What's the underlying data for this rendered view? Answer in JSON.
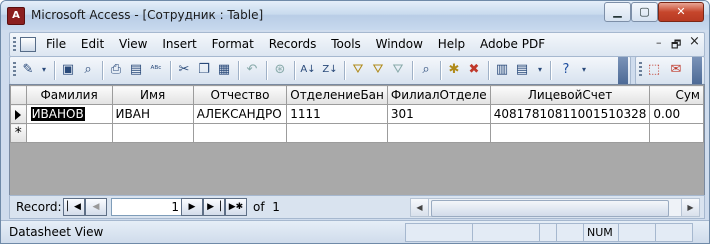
{
  "window": {
    "title": "Microsoft Access - [Сотрудник : Table]",
    "app_icon": "access-key-icon",
    "controls": {
      "minimize": "minimize-icon",
      "maximize": "maximize-icon",
      "close": "close-icon"
    }
  },
  "menubar": {
    "items": [
      {
        "label": "File"
      },
      {
        "label": "Edit"
      },
      {
        "label": "View"
      },
      {
        "label": "Insert"
      },
      {
        "label": "Format"
      },
      {
        "label": "Records"
      },
      {
        "label": "Tools"
      },
      {
        "label": "Window"
      },
      {
        "label": "Help"
      },
      {
        "label": "Adobe PDF"
      }
    ],
    "doc_controls": {
      "minimize": "–",
      "restore": "🗗",
      "close": "×"
    }
  },
  "toolbar": {
    "buttons": [
      "view-icon",
      "save-icon",
      "search-file-icon",
      "print-icon",
      "print-preview-icon",
      "spelling-icon",
      "cut-icon",
      "copy-icon",
      "paste-icon",
      "undo-icon",
      "hyperlink-icon",
      "sort-ascending-icon",
      "sort-descending-icon",
      "filter-by-selection-icon",
      "filter-by-form-icon",
      "apply-filter-icon",
      "find-icon",
      "new-record-icon",
      "delete-record-icon",
      "database-window-icon",
      "new-object-icon",
      "help-icon",
      "pdf-icon",
      "pdf-email-icon"
    ]
  },
  "datasheet": {
    "columns": [
      "Фамилия",
      "Имя",
      "Отчество",
      "ОтделениеБан",
      "ФилиалОтделе",
      "ЛицевойСчет",
      "Сум"
    ],
    "rows": [
      {
        "cells": [
          "ИВАНОВ",
          "ИВАН",
          "АЛЕКСАНДРО",
          "1111",
          "301",
          "40817810811001510328",
          "0.00"
        ],
        "current": true
      }
    ],
    "new_row_marker": "*"
  },
  "record_nav": {
    "label": "Record:",
    "current": "1",
    "of_label": "of",
    "total": "1"
  },
  "statusbar": {
    "view": "Datasheet View",
    "num": "NUM"
  }
}
